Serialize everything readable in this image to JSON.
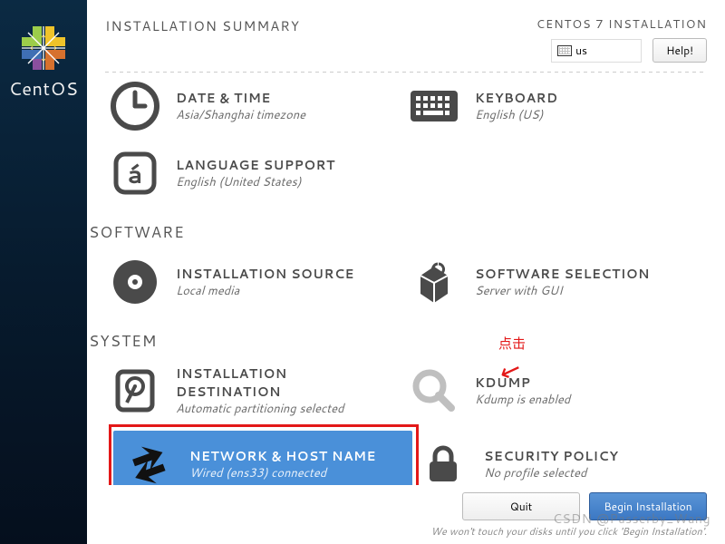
{
  "brand": {
    "name": "CentOS"
  },
  "header": {
    "title": "INSTALLATION SUMMARY",
    "subtitle": "CENTOS 7 INSTALLATION",
    "lang_code": "us",
    "help_label": "Help!"
  },
  "sections": {
    "localization": {
      "datetime": {
        "title": "DATE & TIME",
        "sub": "Asia/Shanghai timezone"
      },
      "keyboard": {
        "title": "KEYBOARD",
        "sub": "English (US)"
      },
      "language": {
        "title": "LANGUAGE SUPPORT",
        "sub": "English (United States)"
      }
    },
    "software": {
      "heading": "SOFTWARE",
      "source": {
        "title": "INSTALLATION SOURCE",
        "sub": "Local media"
      },
      "selection": {
        "title": "SOFTWARE SELECTION",
        "sub": "Server with GUI"
      }
    },
    "system": {
      "heading": "SYSTEM",
      "destination": {
        "title": "INSTALLATION DESTINATION",
        "sub": "Automatic partitioning selected"
      },
      "kdump": {
        "title": "KDUMP",
        "sub": "Kdump is enabled"
      },
      "network": {
        "title": "NETWORK & HOST NAME",
        "sub": "Wired (ens33) connected"
      },
      "security": {
        "title": "SECURITY POLICY",
        "sub": "No profile selected"
      }
    }
  },
  "footer": {
    "quit_label": "Quit",
    "begin_label": "Begin Installation",
    "hint": "We won't touch your disks until you click 'Begin Installation'."
  },
  "annotation": {
    "click_label": "点击"
  },
  "watermark": "CSDN @Passerby_Wang"
}
